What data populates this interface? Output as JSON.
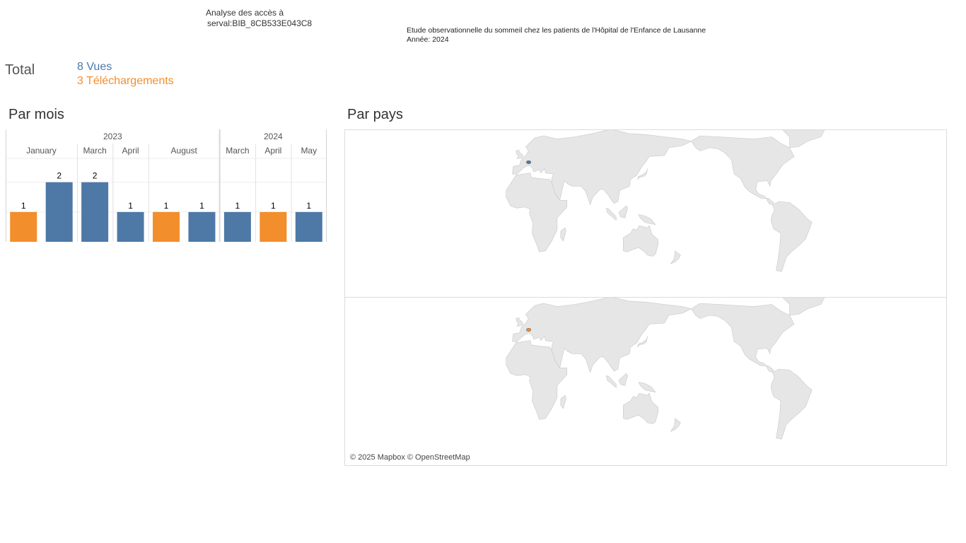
{
  "header": {
    "title_line1": "Analyse des accès à",
    "title_line2": "serval:BIB_8CB533E043C8",
    "study_title": "Etude observationnelle du sommeil chez les patients de l'Hôpital de l'Enfance de Lausanne",
    "year_label": "Année: 2024"
  },
  "totals": {
    "label": "Total",
    "views": "8 Vues",
    "downloads": "3 Téléchargements"
  },
  "sections": {
    "by_month": "Par mois",
    "by_country": "Par pays"
  },
  "colors": {
    "views": "#4e79a7",
    "downloads": "#f28e2b"
  },
  "chart_data": {
    "type": "bar",
    "title": "Par mois",
    "years": [
      {
        "year": "2023",
        "months": [
          "January",
          "March",
          "April",
          "August"
        ]
      },
      {
        "year": "2024",
        "months": [
          "March",
          "April",
          "May"
        ]
      }
    ],
    "bars": [
      {
        "year": "2023",
        "month": "January",
        "series": "Téléchargements",
        "value": 1
      },
      {
        "year": "2023",
        "month": "January",
        "series": "Vues",
        "value": 2
      },
      {
        "year": "2023",
        "month": "March",
        "series": "Vues",
        "value": 2
      },
      {
        "year": "2023",
        "month": "April",
        "series": "Vues",
        "value": 1
      },
      {
        "year": "2023",
        "month": "August",
        "series": "Téléchargements",
        "value": 1
      },
      {
        "year": "2023",
        "month": "August",
        "series": "Vues",
        "value": 1
      },
      {
        "year": "2024",
        "month": "March",
        "series": "Vues",
        "value": 1
      },
      {
        "year": "2024",
        "month": "April",
        "series": "Téléchargements",
        "value": 1
      },
      {
        "year": "2024",
        "month": "May",
        "series": "Vues",
        "value": 1
      }
    ],
    "ylim": [
      0,
      2.8
    ],
    "grid": true,
    "legend": "none"
  },
  "map": {
    "attribution": "© 2025 Mapbox © OpenStreetMap",
    "panels": [
      {
        "series": "Vues",
        "country": "Switzerland",
        "value_color": "#4e79a7"
      },
      {
        "series": "Téléchargements",
        "country": "Switzerland",
        "value_color": "#f28e2b"
      }
    ]
  }
}
